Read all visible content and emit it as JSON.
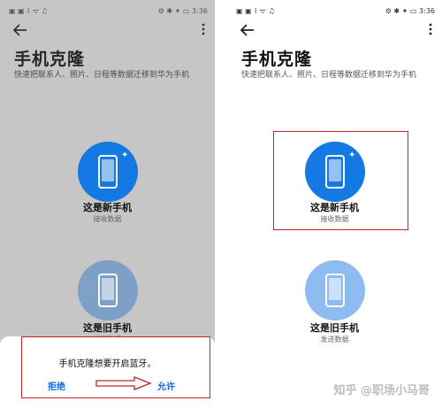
{
  "status_time": "3:36",
  "status_left": "▣ ▣ ⌇ ᯤ ♫",
  "status_right": "⚙ ✱ ✦ ▭",
  "app": {
    "title": "手机克隆",
    "subtitle": "快速把联系人、照片、日程等数据迁移到华为手机"
  },
  "options": {
    "new_phone": {
      "label": "这是新手机",
      "sub": "接收数据"
    },
    "old_phone": {
      "label": "这是旧手机",
      "sub": "发送数据"
    }
  },
  "dialog": {
    "message": "手机克隆想要开启蓝牙。",
    "deny": "拒绝",
    "allow": "允许"
  },
  "watermark": "知乎 @职场小马哥",
  "colors": {
    "new_phone_blue": "#1479e3",
    "old_phone_blue": "#8fbcf0",
    "old_phone_dim_blue": "#7e9fc6",
    "annotation_red": "#c8242a",
    "dialog_button_blue": "#1a66d9"
  },
  "icons": [
    "back-arrow-icon",
    "more-vert-icon",
    "phone-icon",
    "sparkle-icon",
    "right-arrow-annotation"
  ]
}
